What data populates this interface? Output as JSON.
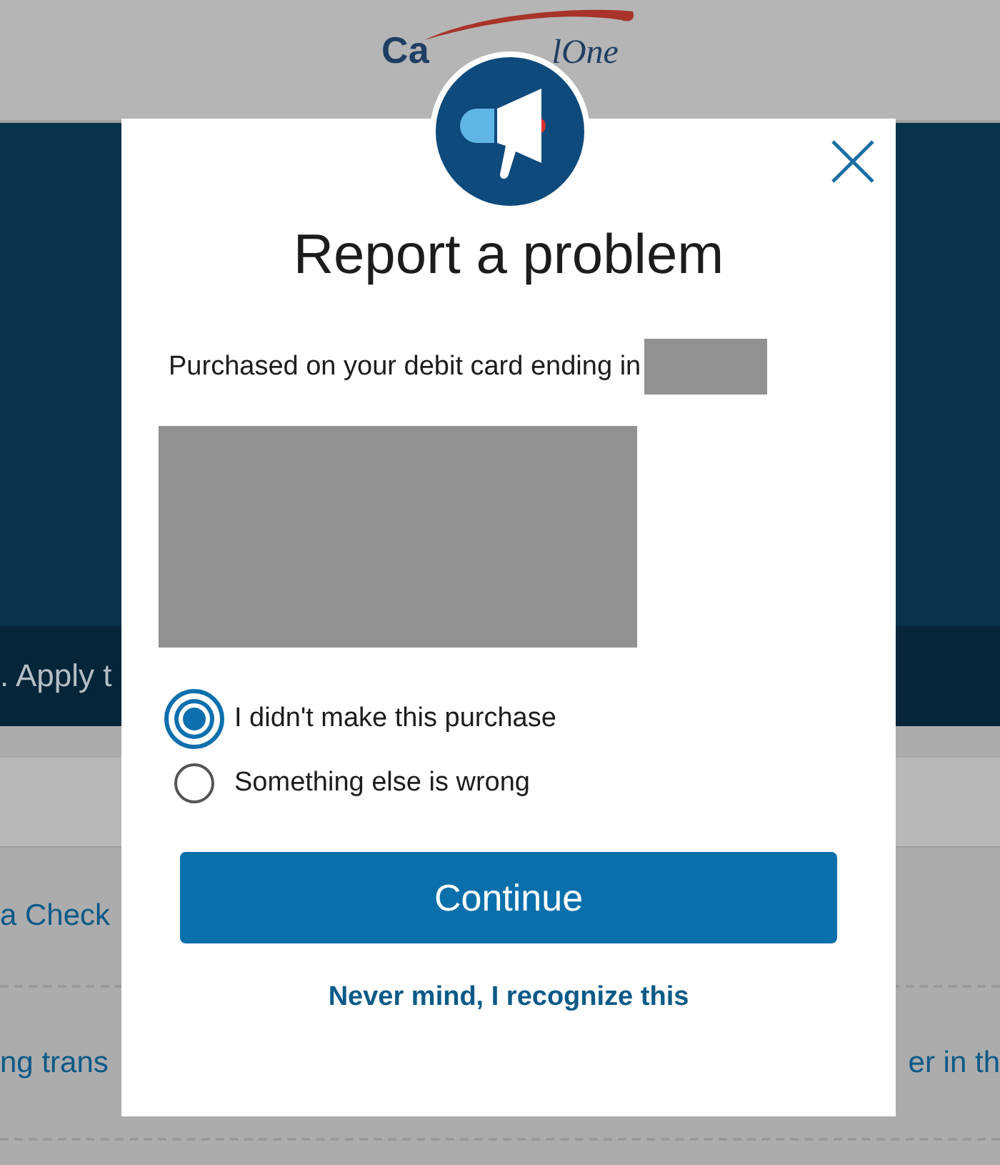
{
  "background": {
    "logo_left": "Ca",
    "logo_right": "lOne",
    "banner_text": ". Apply t",
    "link_rows": [
      {
        "left": "a Check"
      },
      {
        "left": "ng trans",
        "right": "er in th"
      }
    ]
  },
  "dialog": {
    "title": "Report a problem",
    "message": "Purchased on your debit card ending in",
    "options": [
      {
        "label": "I didn't make this purchase",
        "selected": true
      },
      {
        "label": "Something else is wrong",
        "selected": false
      }
    ],
    "primary_button": "Continue",
    "secondary_link": "Never mind, I recognize this"
  }
}
